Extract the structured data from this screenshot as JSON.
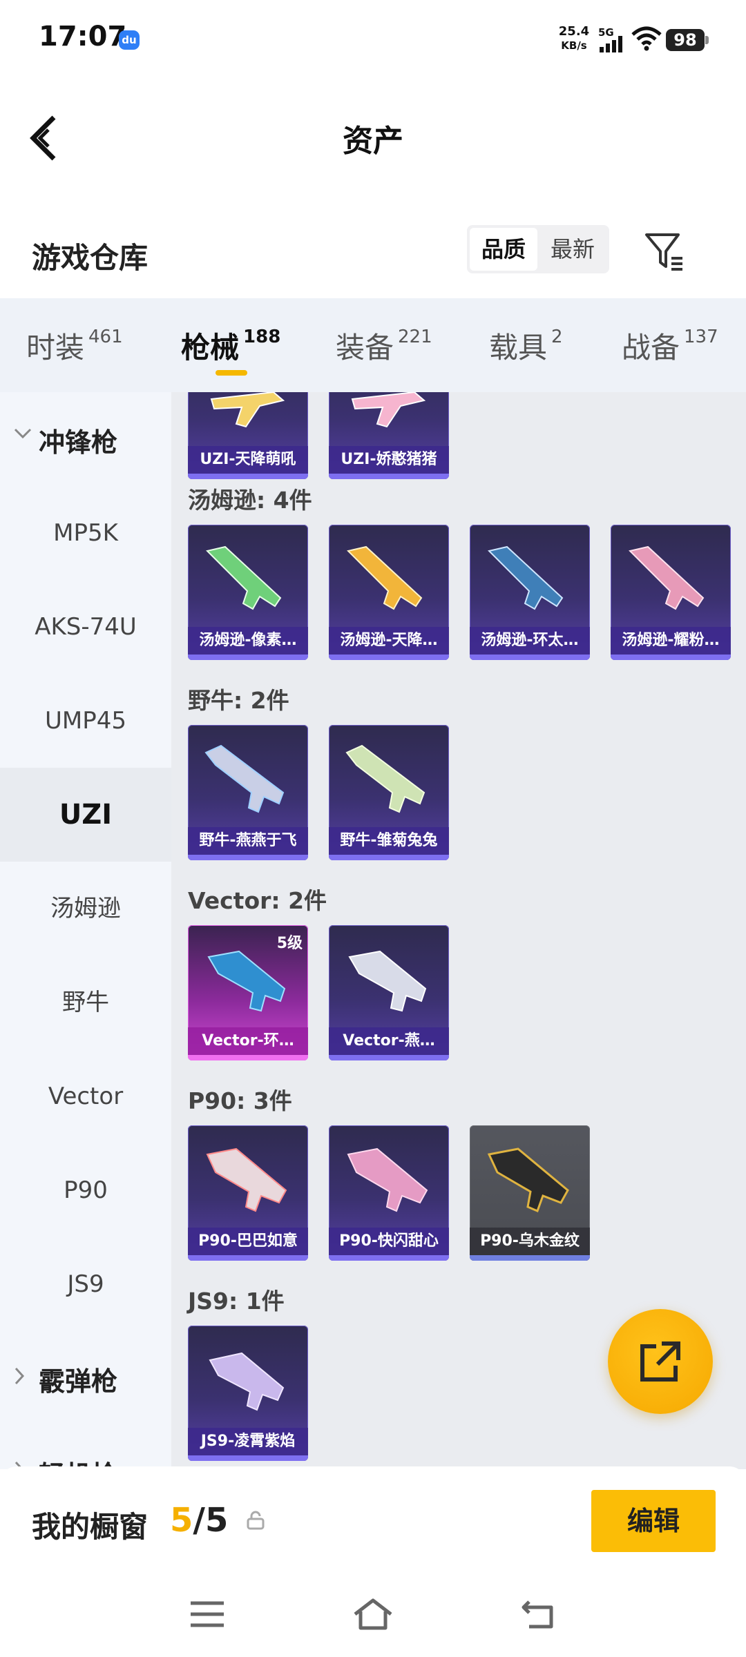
{
  "status_bar": {
    "time": "17:07",
    "app_icon": "du",
    "net_speed": "25.4",
    "net_unit": "KB/s",
    "network": "5G",
    "battery": "98"
  },
  "header": {
    "title": "资产",
    "back_icon": "chevron-left-icon"
  },
  "warehouse": {
    "title": "游戏仓库",
    "sort_options": [
      "品质",
      "最新"
    ],
    "selected_sort": "品质",
    "filter_icon": "filter-icon"
  },
  "tabs": [
    {
      "label": "时装",
      "count": "461"
    },
    {
      "label": "枪械",
      "count": "188"
    },
    {
      "label": "装备",
      "count": "221"
    },
    {
      "label": "载具",
      "count": "2"
    },
    {
      "label": "战备",
      "count": "137"
    }
  ],
  "active_tab": "枪械",
  "sidenav": {
    "groups": [
      "冲锋枪",
      "霰弹枪",
      "轻机枪"
    ],
    "items": [
      "MP5K",
      "AKS-74U",
      "UMP45",
      "UZI",
      "汤姆逊",
      "野牛",
      "Vector",
      "P90",
      "JS9"
    ],
    "active_item": "UZI"
  },
  "sections": [
    {
      "title": "",
      "items": [
        "UZI-天降萌吼",
        "UZI-娇憨猪猪"
      ]
    },
    {
      "title": "汤姆逊: 4件",
      "items": [
        "汤姆逊-像素…",
        "汤姆逊-天降…",
        "汤姆逊-环太…",
        "汤姆逊-耀粉…"
      ]
    },
    {
      "title": "野牛: 2件",
      "items": [
        "野牛-燕燕于飞",
        "野牛-雏菊兔兔"
      ]
    },
    {
      "title": "Vector: 2件",
      "items": [
        "Vector-环…",
        "Vector-燕…"
      ],
      "level_badge": "5级"
    },
    {
      "title": "P90: 3件",
      "items": [
        "P90-巴巴如意",
        "P90-快闪甜心",
        "P90-乌木金纹"
      ]
    },
    {
      "title": "JS9: 1件",
      "items": [
        "JS9-凌霄紫焰"
      ]
    }
  ],
  "fab_icon": "share-external-icon",
  "showcase": {
    "label": "我的橱窗",
    "current": "5",
    "separator": "/",
    "total": "5",
    "edit_label": "编辑"
  },
  "navbar_icons": [
    "menu-icon",
    "home-icon",
    "back-icon"
  ]
}
